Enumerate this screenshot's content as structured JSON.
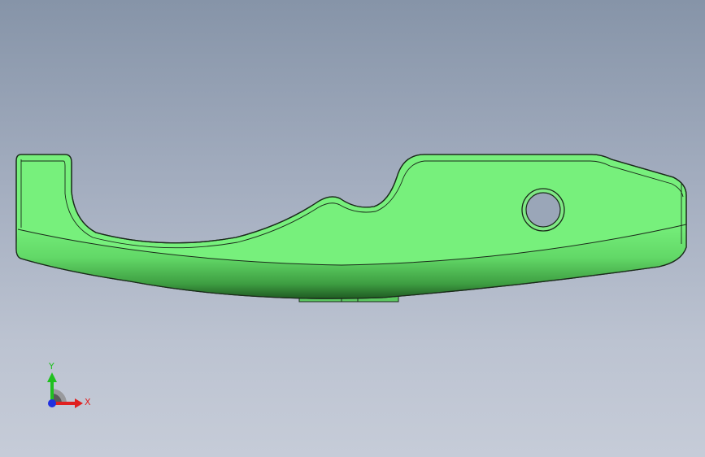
{
  "viewport": {
    "background_top": "#8694a8",
    "background_bottom": "#c6ccd8"
  },
  "part": {
    "body_color": "#77f07c",
    "edge_color": "#1a2a1a",
    "shadow_color": "#2f7a33"
  },
  "triad": {
    "x_label": "X",
    "y_label": "Y",
    "x_color": "#e02020",
    "y_color": "#20c020",
    "z_color": "#2030e0"
  }
}
